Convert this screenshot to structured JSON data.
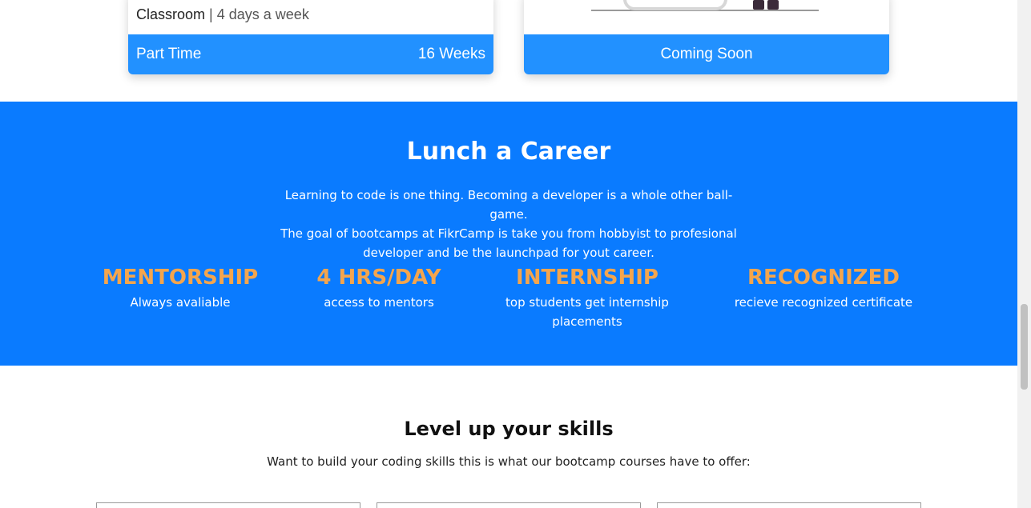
{
  "courses": [
    {
      "mode": "Classroom",
      "separator": "|",
      "schedule": "4 days a week",
      "type": "Part Time",
      "duration": "16 Weeks"
    },
    {
      "status": "Coming Soon"
    }
  ],
  "career": {
    "title": "Lunch a Career",
    "lines": [
      "Learning to code is one thing. Becoming a developer is a whole other ball-game.",
      "The goal of bootcamps at FikrCamp is take you from hobbyist to profesional",
      "developer and be the launchpad for yout career."
    ],
    "stats": [
      {
        "title": "MENTORSHIP",
        "desc": "Always avaliable"
      },
      {
        "title": "4 HRS/DAY",
        "desc": "access to mentors"
      },
      {
        "title": "INTERNSHIP",
        "desc": "top students get internship placements"
      },
      {
        "title": "RECOGNIZED",
        "desc": "recieve recognized certificate"
      }
    ]
  },
  "levelup": {
    "title": "Level up your skills",
    "subtitle": "Want to build your coding skills this is what our bootcamp courses have to offer:"
  },
  "colors": {
    "primary_blue": "#0a7bff",
    "card_footer_blue": "#2291ff",
    "stat_orange": "#f4a54d"
  }
}
